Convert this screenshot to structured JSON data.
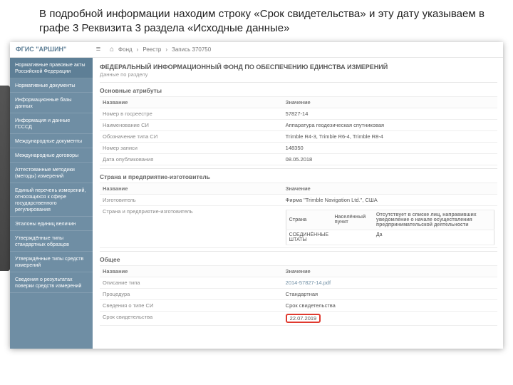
{
  "instruction_text": "В подробной информации находим строку «Срок свидетельства» и эту дату указываем в графе 3 Реквизита 3 раздела «Исходные данные»",
  "brand": "ФГИС \"АРШИН\"",
  "breadcrumb": {
    "home": "⌂",
    "b1": "Фонд",
    "b2": "Реестр",
    "b3": "Запись 370750"
  },
  "sidebar": {
    "items": [
      "Нормативные правовые акты Российской Федерации",
      "Нормативные документы",
      "Информационные базы данных",
      "Информация и данные ГСССД",
      "Международные документы",
      "Международные договоры",
      "Аттестованные методики (методы) измерений",
      "Единый перечень измерений, относящихся к сфере государственного регулирования",
      "Эталоны единиц величин",
      "Утверждённые типы стандартных образцов",
      "Утверждённые типы средств измерений",
      "Сведения о результатах поверки средств измерений"
    ]
  },
  "page": {
    "title": "ФЕДЕРАЛЬНЫЙ ИНФОРМАЦИОННЫЙ ФОНД ПО ОБЕСПЕЧЕНИЮ ЕДИНСТВА ИЗМЕРЕНИЙ",
    "subtitle": "Данные по разделу"
  },
  "sec1": {
    "title": "Основные атрибуты",
    "col1": "Название",
    "col2": "Значение",
    "rows": [
      {
        "k": "Номер в госреестре",
        "v": "57827-14"
      },
      {
        "k": "Наименование СИ",
        "v": "Аппаратура геодезическая спутниковая"
      },
      {
        "k": "Обозначение типа СИ",
        "v": "Trimble R4-3, Trimble R6-4, Trimble R8-4"
      },
      {
        "k": "Номер записи",
        "v": "148350"
      },
      {
        "k": "Дата опубликования",
        "v": "08.05.2018"
      }
    ]
  },
  "sec2": {
    "title": "Страна и предприятие-изготовитель",
    "col1": "Название",
    "col2": "Значение",
    "maker_k": "Изготовитель",
    "maker_v": "Фирма \"Trimble Navigation Ltd.\", США",
    "country_k": "Страна и предприятие-изготовитель",
    "sub": {
      "c1": "Страна",
      "c2": "Населённый пункт",
      "c3": "Отсутствует в списке лиц, направивших уведомление о начале осуществления предпринимательской деятельности",
      "v1": "СОЕДИНЁННЫЕ ШТАТЫ",
      "v2": "",
      "v3": "Да"
    }
  },
  "sec3": {
    "title": "Общее",
    "col1": "Название",
    "col2": "Значение",
    "rows": [
      {
        "k": "Описание типа",
        "v": "2014-57827-14.pdf"
      },
      {
        "k": "Процедура",
        "v": "Стандартная"
      },
      {
        "k": "Сведения о типе СИ",
        "v": "Срок свидетельства"
      },
      {
        "k": "Срок свидетельства",
        "v": "22.07.2019"
      }
    ]
  }
}
